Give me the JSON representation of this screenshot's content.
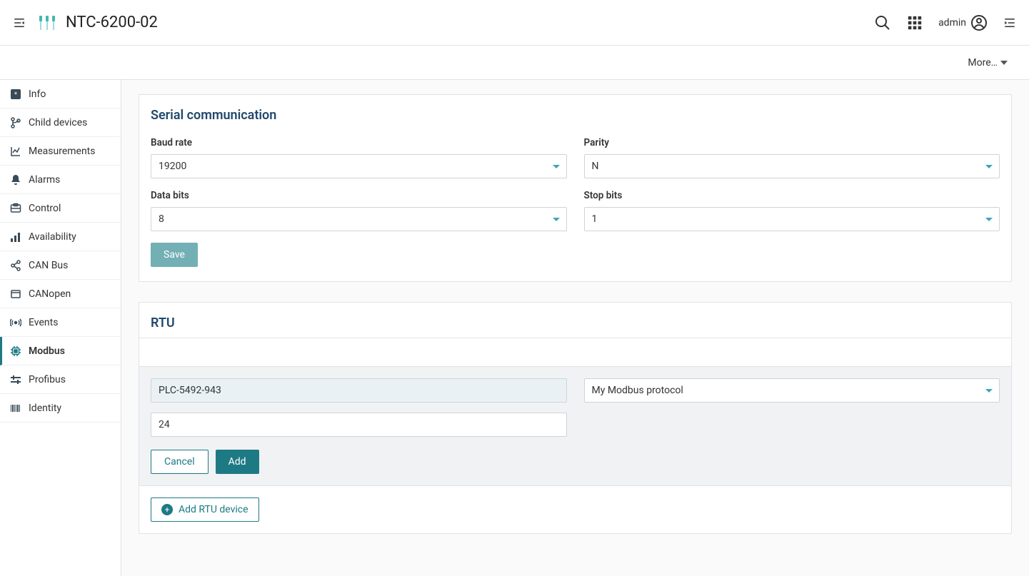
{
  "header": {
    "title": "NTC-6200-02",
    "user_label": "admin",
    "more_label": "More…"
  },
  "sidebar": {
    "items": [
      {
        "label": "Info",
        "icon": "info",
        "active": false
      },
      {
        "label": "Child devices",
        "icon": "branch",
        "active": false
      },
      {
        "label": "Measurements",
        "icon": "linechart",
        "active": false
      },
      {
        "label": "Alarms",
        "icon": "bell",
        "active": false
      },
      {
        "label": "Control",
        "icon": "moneybox",
        "active": false
      },
      {
        "label": "Availability",
        "icon": "bars",
        "active": false
      },
      {
        "label": "CAN Bus",
        "icon": "share",
        "active": false
      },
      {
        "label": "CANopen",
        "icon": "frame",
        "active": false
      },
      {
        "label": "Events",
        "icon": "signal",
        "active": false
      },
      {
        "label": "Modbus",
        "icon": "chip",
        "active": true
      },
      {
        "label": "Profibus",
        "icon": "slider",
        "active": false
      },
      {
        "label": "Identity",
        "icon": "barcode",
        "active": false
      }
    ]
  },
  "serial": {
    "title": "Serial communication",
    "baud_label": "Baud rate",
    "baud_value": "19200",
    "parity_label": "Parity",
    "parity_value": "N",
    "data_bits_label": "Data bits",
    "data_bits_value": "8",
    "stop_bits_label": "Stop bits",
    "stop_bits_value": "1",
    "save_label": "Save"
  },
  "rtu": {
    "title": "RTU",
    "name_value": "PLC-5492-943",
    "protocol_value": "My Modbus protocol",
    "address_value": "24",
    "cancel_label": "Cancel",
    "add_label": "Add",
    "add_device_label": "Add RTU device"
  }
}
